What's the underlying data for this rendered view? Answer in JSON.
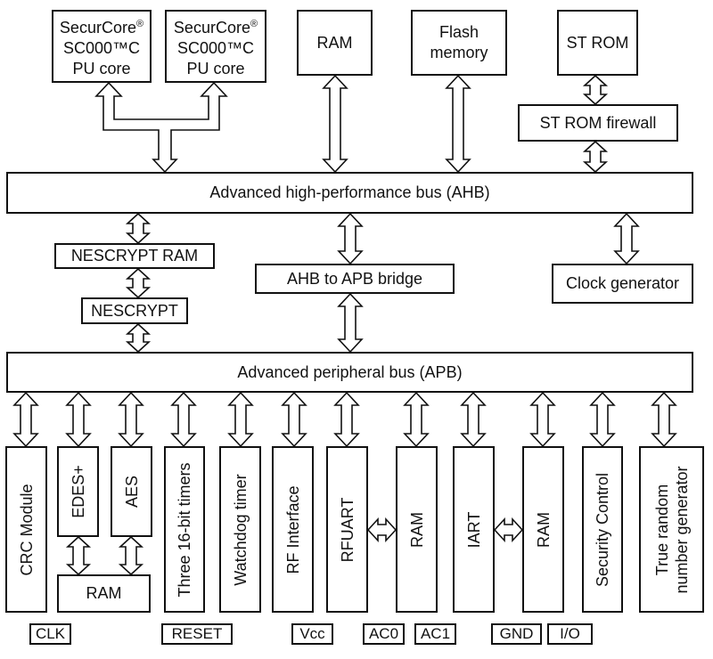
{
  "diagram": {
    "top_row": {
      "cpu_core_1": {
        "line1": "SecurCore",
        "reg": "®",
        "line2": "SC000™C",
        "line3": "PU core"
      },
      "cpu_core_2": {
        "line1": "SecurCore",
        "reg": "®",
        "line2": "SC000™C",
        "line3": "PU core"
      },
      "ram": "RAM",
      "flash": {
        "line1": "Flash",
        "line2": "memory"
      },
      "st_rom": "ST ROM",
      "st_rom_firewall": "ST ROM firewall"
    },
    "ahb": "Advanced high-performance bus (AHB)",
    "middle": {
      "nescrypt_ram": "NESCRYPT RAM",
      "nescrypt": "NESCRYPT",
      "bridge": "AHB to APB bridge",
      "clock_generator": "Clock generator"
    },
    "apb": "Advanced peripheral bus (APB)",
    "peripherals": {
      "crc": "CRC Module",
      "edes": "EDES+",
      "aes": "AES",
      "crypto_ram": "RAM",
      "timers": "Three 16-bit timers",
      "watchdog": "Watchdog timer",
      "rf_interface": "RF Interface",
      "rfuart": "RFUART",
      "rfuart_ram": "RAM",
      "iart": "IART",
      "iart_ram": "RAM",
      "security_control": "Security Control",
      "trng_line1": "True random",
      "trng_line2": "number generator"
    },
    "pins": [
      "CLK",
      "RESET",
      "Vcc",
      "AC0",
      "AC1",
      "GND",
      "I/O"
    ]
  }
}
